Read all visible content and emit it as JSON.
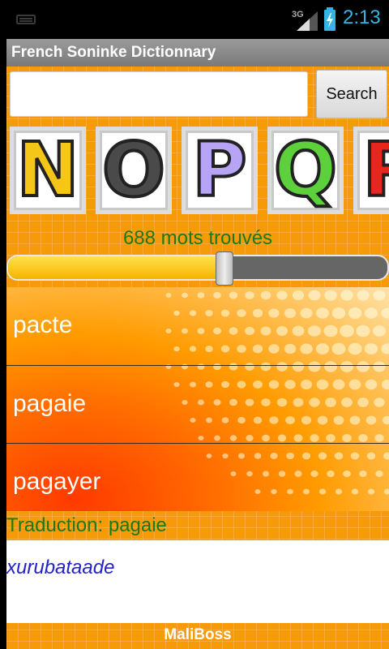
{
  "status_bar": {
    "network": "3G",
    "time": "2:13",
    "icons": [
      "keyboard-icon",
      "signal-icon",
      "battery-charging-icon"
    ],
    "accent": "#33b5e5"
  },
  "app": {
    "title": "French Soninke Dictionnary",
    "search": {
      "value": "",
      "placeholder": "",
      "button_label": "Search"
    },
    "letters": [
      {
        "letter": "N",
        "color": "#f5c518"
      },
      {
        "letter": "O",
        "color": "#4a4a4a"
      },
      {
        "letter": "P",
        "color": "#b7a4f5"
      },
      {
        "letter": "Q",
        "color": "#5cd13c"
      },
      {
        "letter": "R",
        "color": "#e8261c"
      }
    ],
    "result_count": "688 mots trouvés",
    "slider": {
      "value": 0.57
    },
    "words": [
      "pacte",
      "pagaie",
      "pagayer"
    ],
    "translation_label": "Traduction: pagaie",
    "translation_value": "xurubataade",
    "footer": "MaliBoss",
    "colors": {
      "background": "#f79a08",
      "green_text": "#1a7a1a",
      "translation_text": "#2222cc"
    }
  }
}
